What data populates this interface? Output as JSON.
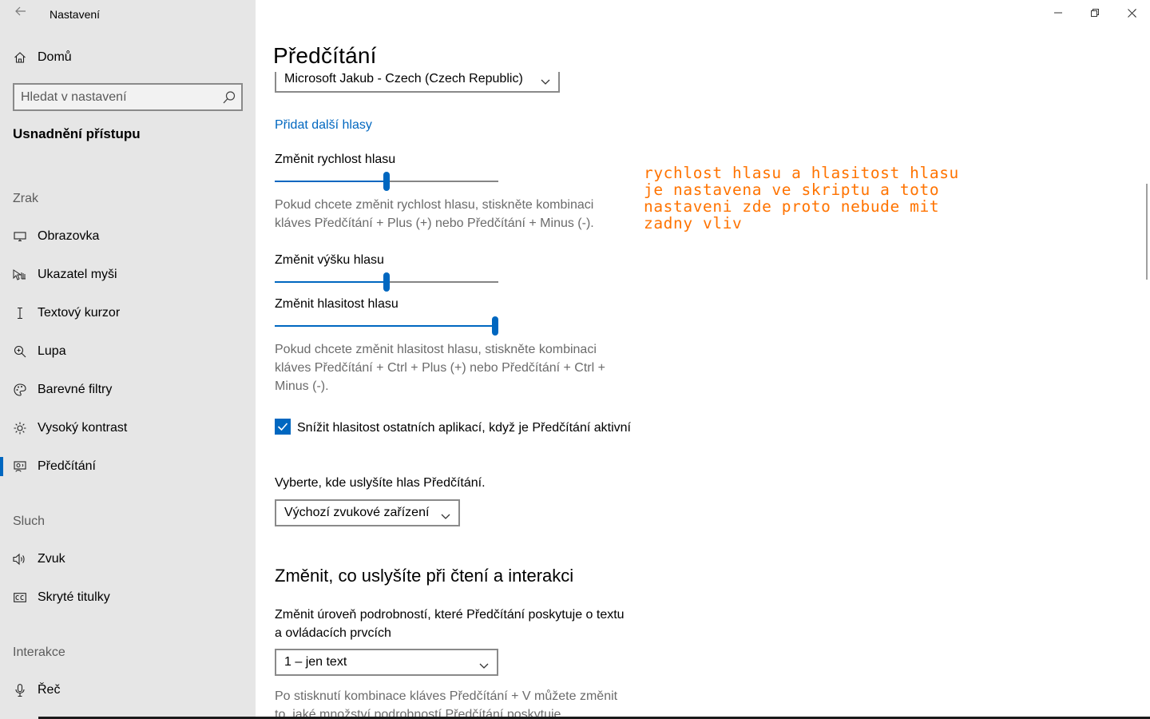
{
  "window": {
    "app_title": "Nastavení",
    "controls": {
      "minimize": "minimize-icon",
      "restore": "restore-icon",
      "close": "close-icon"
    }
  },
  "sidebar": {
    "home_label": "Domů",
    "search": {
      "placeholder": "Hledat v nastavení"
    },
    "section_title": "Usnadnění přístupu",
    "groups": [
      {
        "header": "Zrak",
        "items": [
          {
            "label": "Obrazovka",
            "icon": "monitor-icon"
          },
          {
            "label": "Ukazatel myši",
            "icon": "mouse-pointer-icon"
          },
          {
            "label": "Textový kurzor",
            "icon": "text-cursor-icon"
          },
          {
            "label": "Lupa",
            "icon": "magnifier-icon"
          },
          {
            "label": "Barevné filtry",
            "icon": "color-palette-icon"
          },
          {
            "label": "Vysoký kontrast",
            "icon": "brightness-icon"
          },
          {
            "label": "Předčítání",
            "icon": "narrator-icon",
            "active": true
          }
        ]
      },
      {
        "header": "Sluch",
        "items": [
          {
            "label": "Zvuk",
            "icon": "speaker-icon"
          },
          {
            "label": "Skryté titulky",
            "icon": "closed-captions-icon"
          }
        ]
      },
      {
        "header": "Interakce",
        "items": [
          {
            "label": "Řeč",
            "icon": "microphone-icon"
          }
        ]
      }
    ]
  },
  "main": {
    "page_title": "Předčítání",
    "voice_select_value": "Microsoft Jakub - Czech (Czech Republic)",
    "add_voices_link": "Přidat další hlasy",
    "speed": {
      "label": "Změnit rychlost hlasu",
      "value_fraction": 0.5,
      "help": "Pokud chcete změnit rychlost hlasu, stiskněte kombinaci kláves Předčítání + Plus (+) nebo Předčítání + Minus (-)."
    },
    "pitch": {
      "label": "Změnit výšku hlasu",
      "value_fraction": 0.5
    },
    "volume": {
      "label": "Změnit hlasitost hlasu",
      "value_fraction": 1.0,
      "help": "Pokud chcete změnit hlasitost hlasu, stiskněte kombinaci kláves Předčítání + Ctrl + Plus (+) nebo Předčítání + Ctrl + Minus (-)."
    },
    "lower_volume_checkbox": {
      "checked": true,
      "label": "Snížit hlasitost ostatních aplikací, když je Předčítání aktivní"
    },
    "output_device": {
      "label": "Vyberte, kde uslyšíte hlas Předčítání.",
      "value": "Výchozí zvukové zařízení"
    },
    "section2_title": "Změnit, co uslyšíte při čtení a interakci",
    "detail_level": {
      "label": "Změnit úroveň podrobností, které Předčítání poskytuje o textu a ovládacích prvcích",
      "value": "1 – jen text",
      "help": "Po stisknutí kombinace kláves Předčítání + V můžete změnit to, jaké množství podrobností Předčítání poskytuje"
    }
  },
  "annotation": {
    "text": "rychlost hlasu a hlasitost hlasu\nje nastavena ve skriptu a toto\nnastaveni zde proto nebude mit\nzadny vliv",
    "color": "#ff7300"
  },
  "colors": {
    "accent": "#0067c0",
    "sidebar_bg": "#e6e6e6"
  }
}
